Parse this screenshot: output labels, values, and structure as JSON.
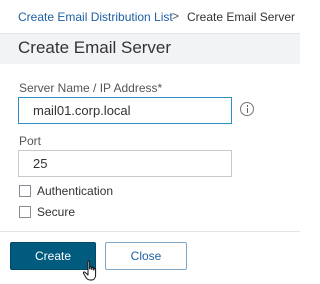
{
  "breadcrumb": {
    "parent": "Create Email Distribution List",
    "separator": ">",
    "current": "Create Email Server"
  },
  "page_title": "Create Email Server",
  "form": {
    "server_label": "Server Name / IP Address*",
    "server_value": "mail01.corp.local",
    "port_label": "Port",
    "port_value": "25",
    "authentication_label": "Authentication",
    "authentication_checked": false,
    "secure_label": "Secure",
    "secure_checked": false
  },
  "actions": {
    "create_label": "Create",
    "close_label": "Close"
  },
  "colors": {
    "primary": "#005b7f",
    "link": "#1f5fa3",
    "focus_border": "#2f8ec4"
  },
  "icons": [
    "info-icon",
    "hand-pointer-cursor"
  ]
}
